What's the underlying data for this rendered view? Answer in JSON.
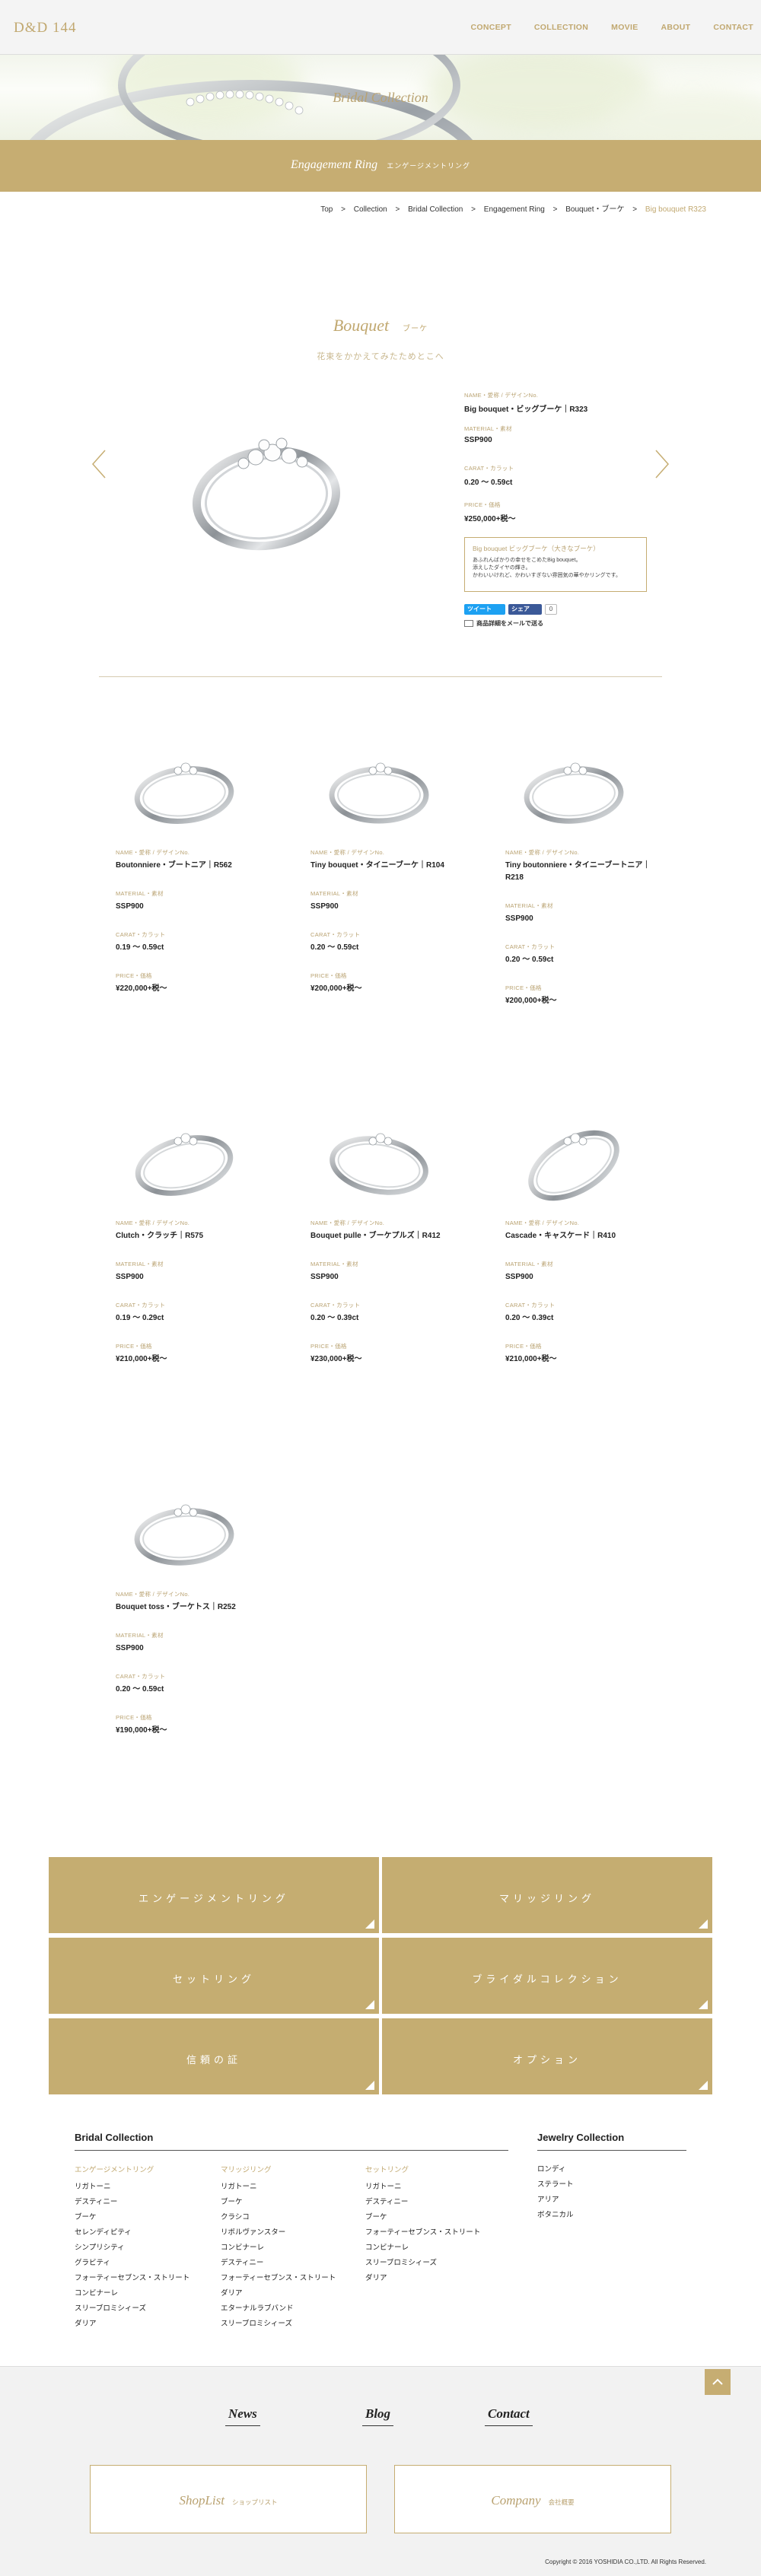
{
  "header": {
    "logo": "D&D 144",
    "nav": [
      "CONCEPT",
      "COLLECTION",
      "MOVIE",
      "ABOUT",
      "CONTACT"
    ]
  },
  "hero": {
    "title": "Bridal Collection"
  },
  "banner": {
    "title": "Engagement Ring",
    "subtitle": "エンゲージメントリング"
  },
  "breadcrumb": [
    "Top",
    "Collection",
    "Bridal Collection",
    "Engagement Ring",
    "Bouquet・ブーケ",
    "Big bouquet R323"
  ],
  "breadcrumb_sep": ">",
  "product": {
    "title": "Bouquet",
    "title_jp": "ブーケ",
    "tagline": "花束をかかえてみたためとこへ",
    "name_label": "NAME・愛称 / デザインNo.",
    "name": "Big bouquet・ビッグブーケ｜R323",
    "material_label": "MATERIAL・素材",
    "material": "SSP900",
    "carat_label": "CARAT・カラット",
    "carat": "0.20 〜 0.59ct",
    "price_label": "PRICE・価格",
    "price": "¥250,000+税〜",
    "info_title": "Big bouquet ビッグブーケ（大きなブーケ）",
    "info_lines": [
      "あふれんばかりの幸せをこめたBig bouquet。",
      "添えしたダイヤの輝き。",
      "かわいいけれど、かわいすぎない雰囲気の華やかリングです。"
    ],
    "tweet": "ツイート",
    "share": "シェア",
    "share_count": "0",
    "mail_text": "商品詳細をメールで送る"
  },
  "items": [
    {
      "name": "Boutonniere・ブートニア｜R562",
      "material": "SSP900",
      "carat": "0.19 〜 0.59ct",
      "price": "¥220,000+税〜"
    },
    {
      "name": "Tiny bouquet・タイニーブーケ｜R104",
      "material": "SSP900",
      "carat": "0.20 〜 0.59ct",
      "price": "¥200,000+税〜"
    },
    {
      "name": "Tiny boutonniere・タイニーブートニア｜R218",
      "material": "SSP900",
      "carat": "0.20 〜 0.59ct",
      "price": "¥200,000+税〜"
    },
    {
      "name": "Clutch・クラッチ｜R575",
      "material": "SSP900",
      "carat": "0.19 〜 0.29ct",
      "price": "¥210,000+税〜"
    },
    {
      "name": "Bouquet pulle・ブーケプルズ｜R412",
      "material": "SSP900",
      "carat": "0.20 〜 0.39ct",
      "price": "¥230,000+税〜"
    },
    {
      "name": "Cascade・キャスケード｜R410",
      "material": "SSP900",
      "carat": "0.20 〜 0.39ct",
      "price": "¥210,000+税〜"
    },
    {
      "name": "Bouquet toss・ブーケトス｜R252",
      "material": "SSP900",
      "carat": "0.20 〜 0.59ct",
      "price": "¥190,000+税〜"
    }
  ],
  "labels": {
    "name": "NAME・愛称 / デザインNo.",
    "material": "MATERIAL・素材",
    "carat": "CARAT・カラット",
    "price": "PRICE・価格"
  },
  "tiles": [
    "エンゲージメントリング",
    "マリッジリング",
    "セットリング",
    "ブライダルコレクション",
    "信頼の証",
    "オプション"
  ],
  "links": {
    "bridal_title": "Bridal Collection",
    "jewelry_title": "Jewelry Collection",
    "engagement": {
      "heading": "エンゲージメントリング",
      "items": [
        "リガトーニ",
        "デスティニー",
        "ブーケ",
        "セレンディピティ",
        "シンプリシティ",
        "グラビティ",
        "フォーティーセブンス・ストリート",
        "コンビナーレ",
        "スリーブロミシィーズ",
        "ダリア"
      ]
    },
    "marriage": {
      "heading": "マリッジリング",
      "items": [
        "リガトーニ",
        "ブーケ",
        "クラシコ",
        "リボルヴァンスター",
        "コンビナーレ",
        "デスティニー",
        "フォーティーセブンス・ストリート",
        "ダリア",
        "エターナルラブバンド",
        "スリーブロミシィーズ"
      ]
    },
    "set": {
      "heading": "セットリング",
      "items": [
        "リガトーニ",
        "デスティニー",
        "ブーケ",
        "フォーティーセブンス・ストリート",
        "コンビナーレ",
        "スリーブロミシィーズ",
        "ダリア"
      ]
    },
    "jewelry": {
      "items": [
        "ロンディ",
        "ステラート",
        "アリア",
        "ボタニカル"
      ]
    }
  },
  "footer": {
    "nav": [
      "News",
      "Blog",
      "Contact"
    ],
    "boxes": [
      {
        "en": "ShopList",
        "jp": "ショップリスト"
      },
      {
        "en": "Company",
        "jp": "会社概要"
      }
    ],
    "copyright": "Copyright © 2016 YOSHIDIA CO.,LTD. All Rights Reserved."
  },
  "colors": {
    "gold": "#c6ad72",
    "gold_text": "#b9a271"
  }
}
